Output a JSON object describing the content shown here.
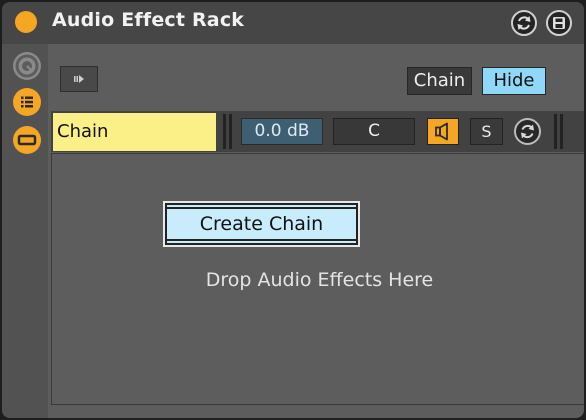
{
  "device": {
    "title": "Audio Effect Rack",
    "power_color": "#f5a623"
  },
  "title_icons": [
    "hot-swap-icon",
    "save-icon"
  ],
  "left_icons": [
    "macro-knob-icon",
    "chain-list-icon",
    "device-view-icon"
  ],
  "chain_list": {
    "chain_button": "Chain",
    "hide_button": "Hide"
  },
  "chain": {
    "name": "Chain",
    "volume": "0.0 dB",
    "pan": "C",
    "solo": "S",
    "activator_color": "#f5a623"
  },
  "drop_area": {
    "create_chain": "Create Chain",
    "hint": "Drop Audio Effects Here"
  }
}
